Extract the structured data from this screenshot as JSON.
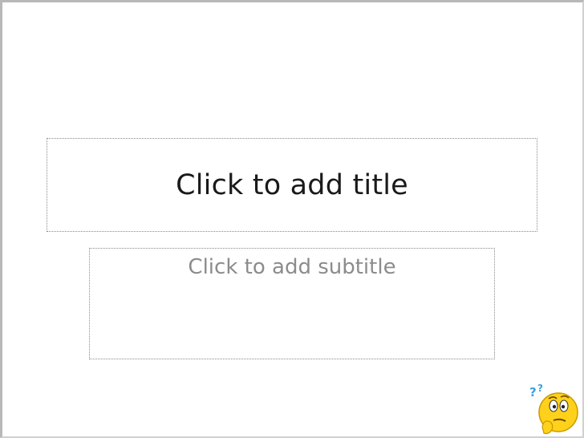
{
  "slide": {
    "title_placeholder": "Click to add title",
    "subtitle_placeholder": "Click to add subtitle"
  },
  "helper": {
    "icon": "thinking-face-icon",
    "marks": "??"
  },
  "colors": {
    "background": "#ffffff",
    "title_text": "#1a1a1a",
    "subtitle_text": "#8c8c8c",
    "placeholder_border": "#8a8a8a",
    "helper_face": "#ffd11a",
    "helper_marks": "#3aa0e0"
  }
}
